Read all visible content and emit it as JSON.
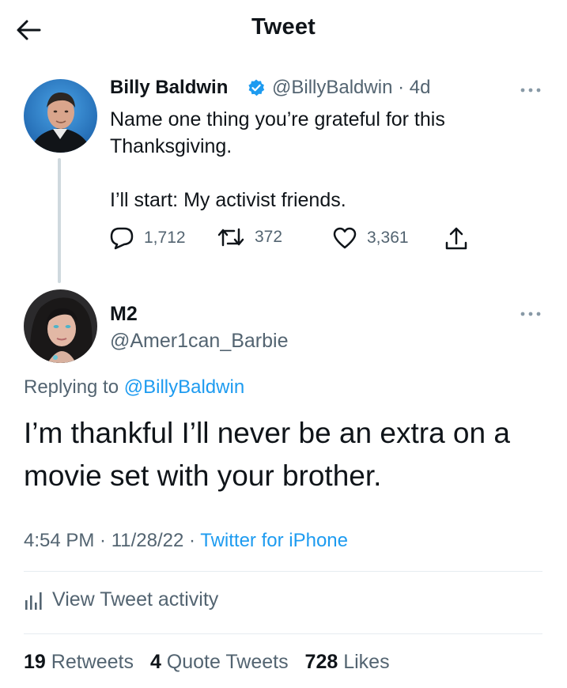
{
  "header": {
    "title": "Tweet",
    "back_icon": "arrow-left-icon"
  },
  "parent_tweet": {
    "name": "Billy Baldwin",
    "handle_time": "@BillyBaldwin · 4d",
    "text": "Name one thing you’re grateful for this\nThanksgiving.\n\nI’ll start: My activist friends.",
    "replies": "1,712",
    "retweets": "372",
    "likes": "3,361",
    "colors": {
      "verified": "#1d9bf0"
    }
  },
  "reply_tweet": {
    "name": "M2",
    "handle": "@Amer1can_Barbie",
    "replying_label": "Replying to",
    "replying_to": "@BillyBaldwin",
    "text": "I’m thankful I’ll never be an extra on a movie set with your brother.",
    "time": "4:54 PM · 11/28/22 · ",
    "source": "Twitter for iPhone"
  },
  "activity": {
    "label": "View Tweet activity"
  },
  "stats": {
    "retweets_count": "19",
    "retweets_label": "Retweets",
    "quotes_count": "4",
    "quotes_label": "Quote Tweets",
    "likes_count": "728",
    "likes_label": "Likes"
  },
  "colors": {
    "link": "#1d9bf0",
    "muted": "#536471",
    "text": "#0f1419"
  }
}
